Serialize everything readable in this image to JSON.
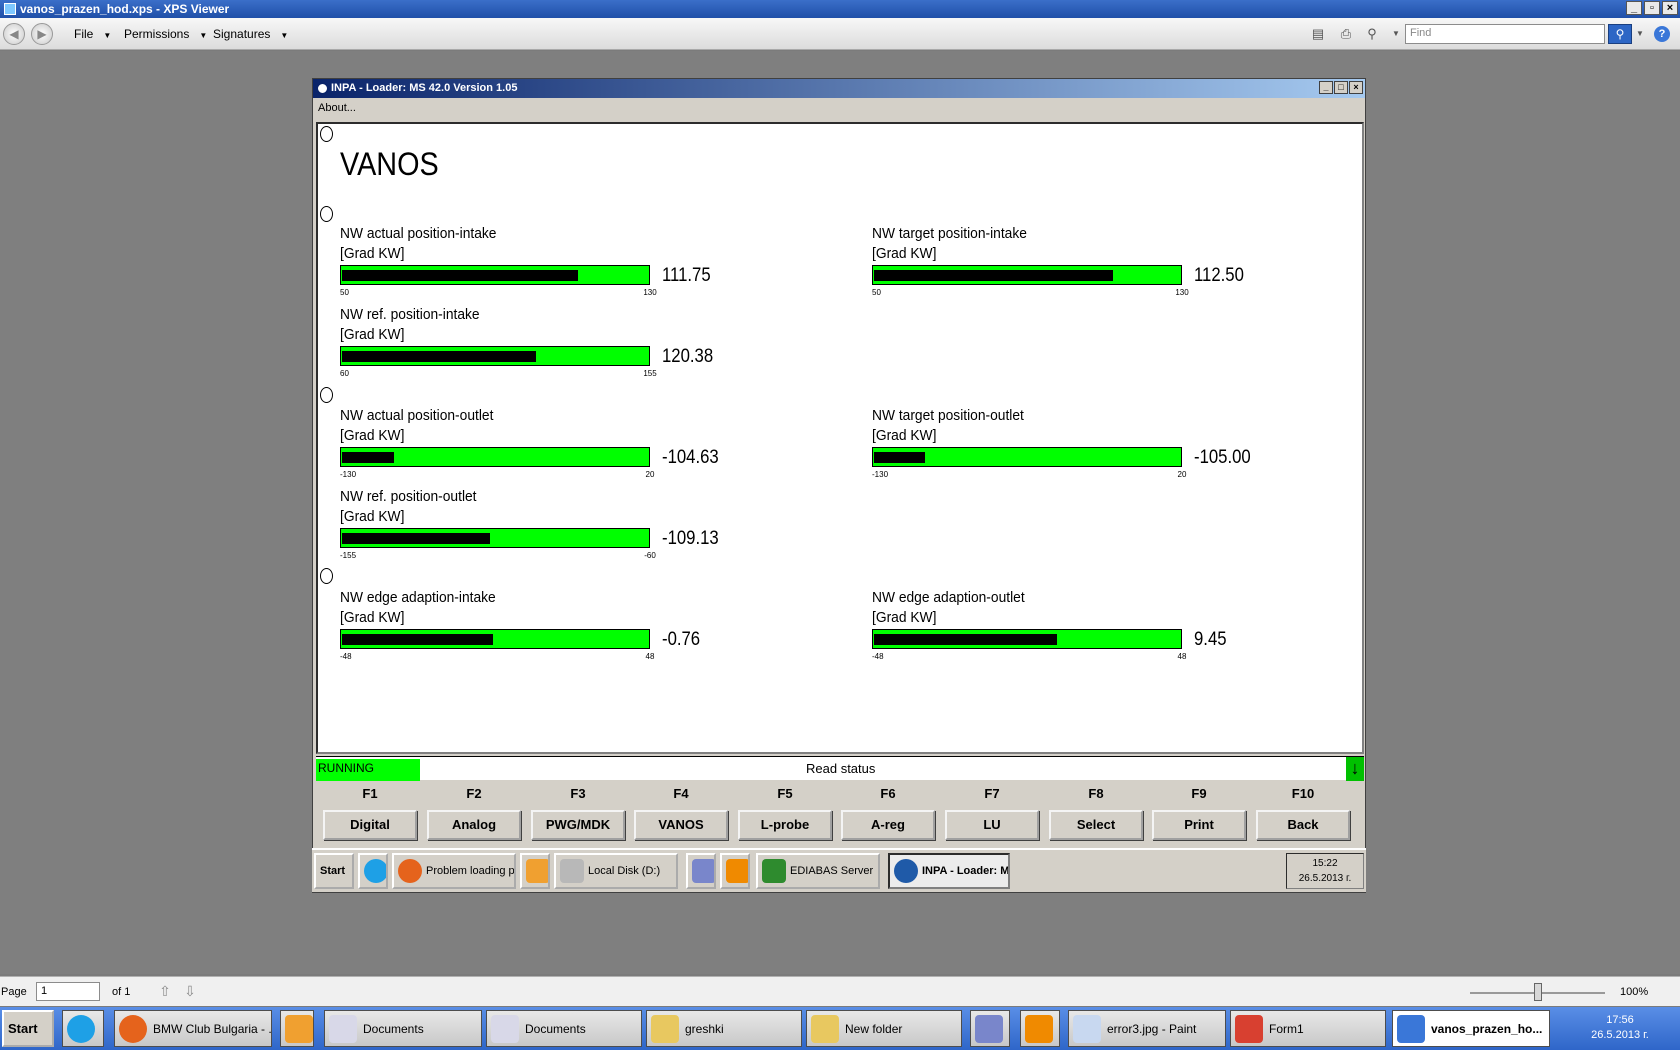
{
  "xps": {
    "title": "vanos_prazen_hod.xps - XPS Viewer",
    "menus": [
      "File",
      "Permissions",
      "Signatures"
    ],
    "find_placeholder": "Find",
    "page_label": "Page",
    "page_value": "1",
    "page_of": "of 1",
    "zoom": "100%"
  },
  "inpa": {
    "title": "INPA - Loader:  MS 42.0 Version 1.05",
    "menu_about": "About...",
    "screen_title": "VANOS",
    "gauges": [
      {
        "label": "NW actual position-intake",
        "unit": "[Grad KW]",
        "min": "50",
        "max": "130",
        "value": "111.75",
        "level": 0.77
      },
      {
        "label": "NW target position-intake",
        "unit": "[Grad KW]",
        "min": "50",
        "max": "130",
        "value": "112.50",
        "level": 0.78
      },
      {
        "label": "NW ref. position-intake",
        "unit": "[Grad KW]",
        "min": "60",
        "max": "155",
        "value": "120.38",
        "level": 0.635
      },
      {
        "label": "NW actual position-outlet",
        "unit": "[Grad KW]",
        "min": "-130",
        "max": "20",
        "value": "-104.63",
        "level": 0.17
      },
      {
        "label": "NW target position-outlet",
        "unit": "[Grad KW]",
        "min": "-130",
        "max": "20",
        "value": "-105.00",
        "level": 0.167
      },
      {
        "label": "NW ref. position-outlet",
        "unit": "[Grad KW]",
        "min": "-155",
        "max": "-60",
        "value": "-109.13",
        "level": 0.484
      },
      {
        "label": "NW edge adaption-intake",
        "unit": "[Grad KW]",
        "min": "-48",
        "max": "48",
        "value": "-0.76",
        "level": 0.492
      },
      {
        "label": "NW edge adaption-outlet",
        "unit": "[Grad KW]",
        "min": "-48",
        "max": "48",
        "value": "9.45",
        "level": 0.598
      }
    ],
    "status_running": "RUNNING",
    "status_read": "Read status",
    "fkeys": [
      {
        "key": "F1",
        "label": "Digital"
      },
      {
        "key": "F2",
        "label": "Analog"
      },
      {
        "key": "F3",
        "label": "PWG/MDK"
      },
      {
        "key": "F4",
        "label": "VANOS"
      },
      {
        "key": "F5",
        "label": "L-probe"
      },
      {
        "key": "F6",
        "label": "A-reg"
      },
      {
        "key": "F7",
        "label": "LU"
      },
      {
        "key": "F8",
        "label": "Select"
      },
      {
        "key": "F9",
        "label": "Print"
      },
      {
        "key": "F10",
        "label": "Back"
      }
    ]
  },
  "inner_taskbar": {
    "start": "Start",
    "items": [
      "Problem loading page...",
      "Local Disk (D:)",
      "EDIABAS Server",
      "INPA - Loader:  MS ..."
    ],
    "time": "15:22",
    "date": "26.5.2013 г."
  },
  "taskbar": {
    "start": "Start",
    "items": [
      "BMW Club Bulgaria - ...",
      "Documents",
      "Documents",
      "greshki",
      "New folder",
      "error3.jpg - Paint",
      "Form1",
      "vanos_prazen_ho..."
    ],
    "time": "17:56",
    "date": "26.5.2013 г."
  },
  "colors": {
    "gauge_bar": "#00ff00",
    "gauge_fill": "#000000",
    "running": "#00ff00"
  }
}
